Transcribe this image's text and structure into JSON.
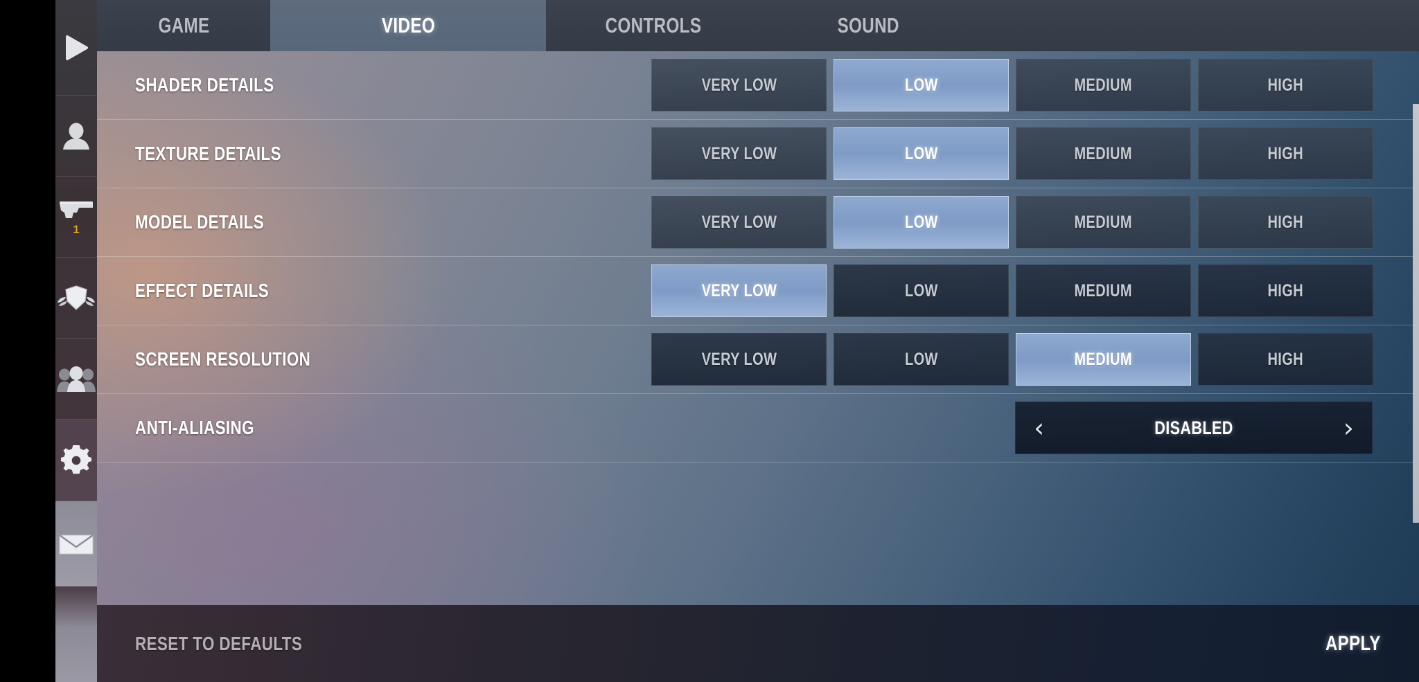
{
  "sidebar": {
    "items": [
      {
        "name": "play",
        "icon": "play-icon",
        "badge": null
      },
      {
        "name": "profile",
        "icon": "person-icon",
        "badge": null
      },
      {
        "name": "weapons",
        "icon": "pistol-icon",
        "badge": "1"
      },
      {
        "name": "clan",
        "icon": "shield-crest-icon",
        "badge": null
      },
      {
        "name": "friends",
        "icon": "people-group-icon",
        "badge": null
      },
      {
        "name": "settings",
        "icon": "gear-icon",
        "badge": null
      },
      {
        "name": "mail",
        "icon": "envelope-icon",
        "badge": null
      }
    ]
  },
  "tabs": [
    {
      "label": "GAME",
      "active": false
    },
    {
      "label": "VIDEO",
      "active": true
    },
    {
      "label": "CONTROLS",
      "active": false
    },
    {
      "label": "SOUND",
      "active": false
    }
  ],
  "settings": {
    "rows": [
      {
        "label": "SHADER DETAILS",
        "type": "options",
        "options": [
          "VERY LOW",
          "LOW",
          "MEDIUM",
          "HIGH"
        ],
        "selected": "LOW"
      },
      {
        "label": "TEXTURE DETAILS",
        "type": "options",
        "options": [
          "VERY LOW",
          "LOW",
          "MEDIUM",
          "HIGH"
        ],
        "selected": "LOW"
      },
      {
        "label": "MODEL DETAILS",
        "type": "options",
        "options": [
          "VERY LOW",
          "LOW",
          "MEDIUM",
          "HIGH"
        ],
        "selected": "LOW"
      },
      {
        "label": "EFFECT DETAILS",
        "type": "options",
        "options": [
          "VERY LOW",
          "LOW",
          "MEDIUM",
          "HIGH"
        ],
        "selected": "VERY LOW"
      },
      {
        "label": "SCREEN RESOLUTION",
        "type": "options",
        "options": [
          "VERY LOW",
          "LOW",
          "MEDIUM",
          "HIGH"
        ],
        "selected": "MEDIUM"
      },
      {
        "label": "ANTI-ALIASING",
        "type": "stepper",
        "value": "DISABLED",
        "prev_arrow": "‹",
        "next_arrow": "›"
      }
    ]
  },
  "footer": {
    "reset_label": "RESET TO DEFAULTS",
    "apply_label": "APPLY"
  },
  "colors": {
    "accent_selected": "#8fa9cf",
    "tab_active_bg": "#5d6b7d",
    "badge_gold": "#e0a22a",
    "text_primary": "#ffffff",
    "text_muted": "#b6b0b2"
  }
}
